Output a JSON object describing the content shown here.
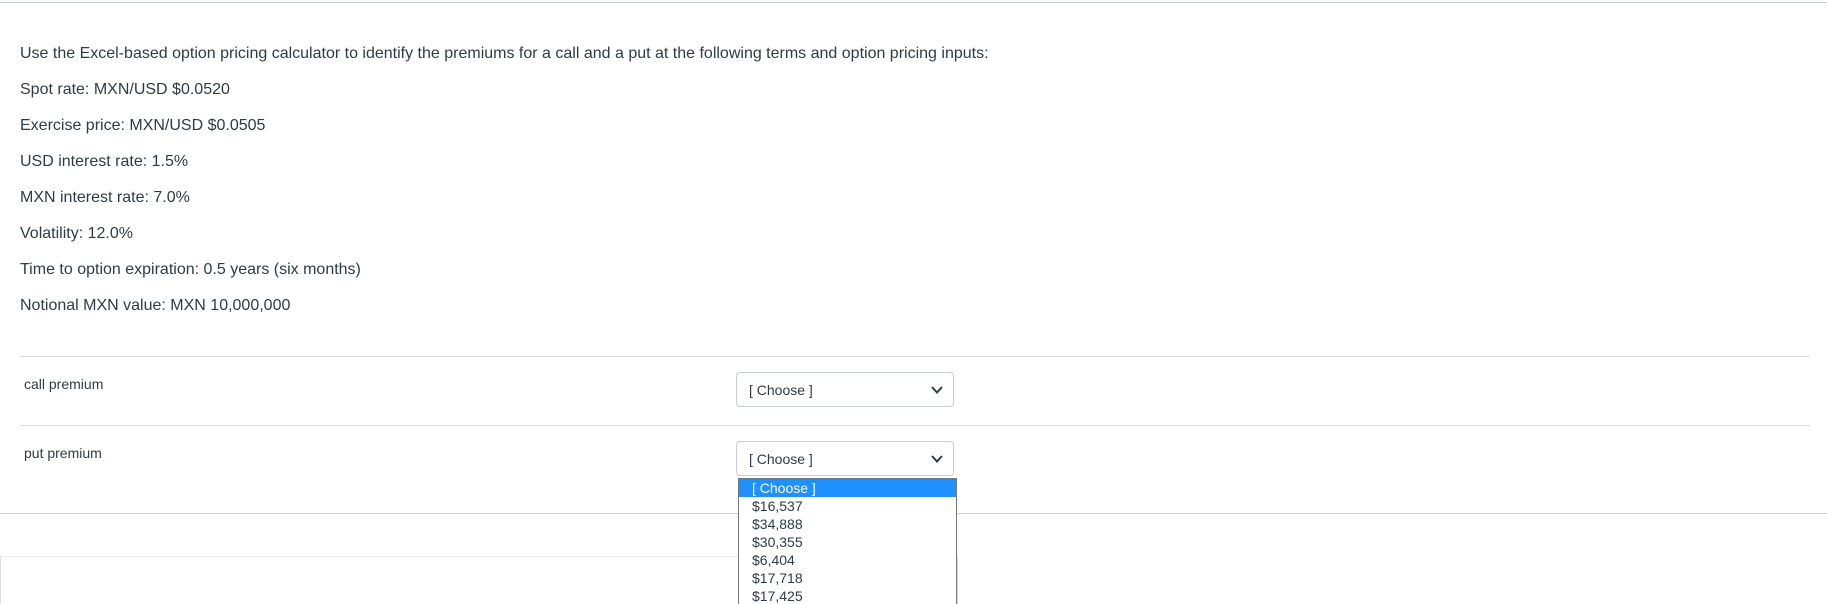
{
  "question": {
    "intro": "Use the Excel-based option pricing calculator to identify the premiums for a call and a put at the following terms and option pricing inputs:",
    "spot_rate": "Spot rate:  MXN/USD $0.0520",
    "exercise_price": "Exercise price:  MXN/USD $0.0505",
    "usd_interest": "USD interest rate: 1.5%",
    "mxn_interest": "MXN interest rate: 7.0%",
    "volatility": "Volatility:  12.0%",
    "time_to_expiration": "Time to option expiration:  0.5 years (six months)",
    "notional": "Notional MXN value:  MXN 10,000,000"
  },
  "answers": {
    "call": {
      "label": "call premium",
      "selected": "[ Choose ]"
    },
    "put": {
      "label": "put premium",
      "selected": "[ Choose ]"
    }
  },
  "dropdown": {
    "options": [
      "[ Choose ]",
      "$16,537",
      "$34,888",
      "$30,355",
      "$6,404",
      "$17,718",
      "$17,425"
    ],
    "highlighted_index": 0,
    "highlight_color": "#1e90ff"
  },
  "colors": {
    "text": "#2d3b45",
    "rule": "#c7cdd1"
  },
  "icons": {
    "select_chevron": "chevron-down-icon"
  }
}
